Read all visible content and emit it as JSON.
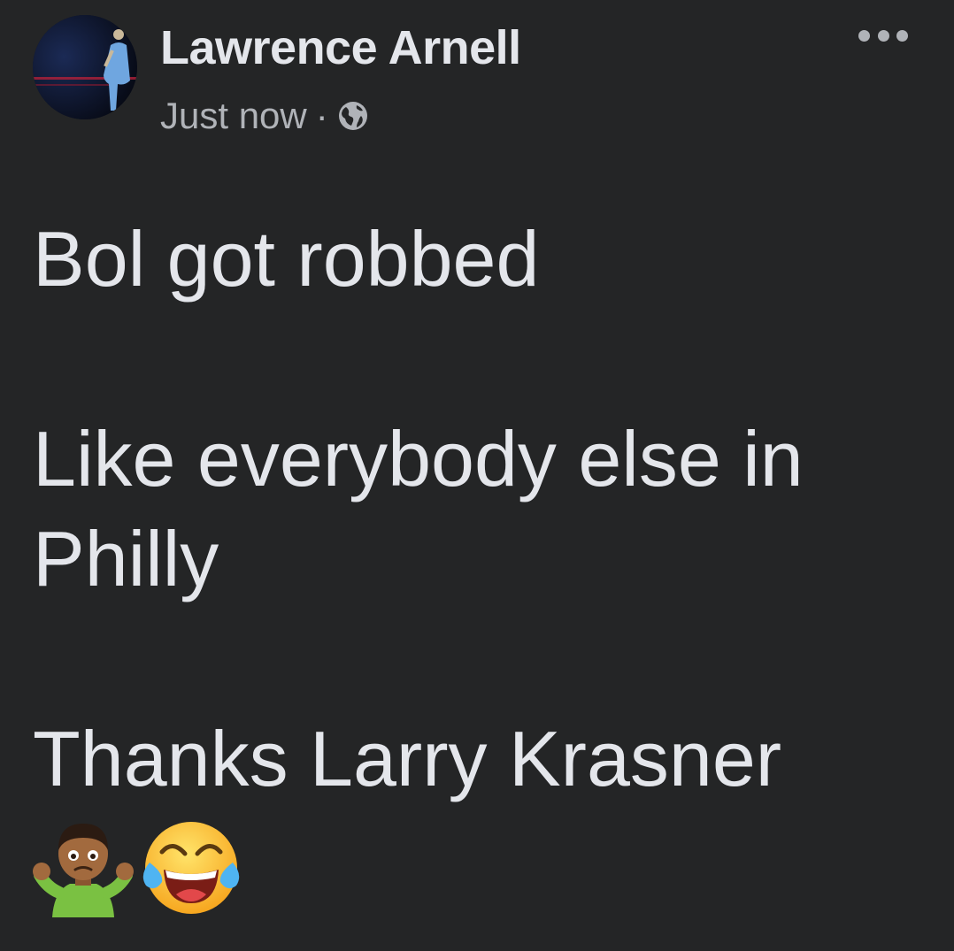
{
  "post": {
    "author_name": "Lawrence Arnell",
    "timestamp": "Just now",
    "separator": "·",
    "privacy_icon": "globe-icon",
    "more_icon": "more-options-icon",
    "lines": [
      "Bol got robbed",
      "",
      "Like everybody else in",
      "Philly",
      "",
      "Thanks Larry Krasner"
    ],
    "emojis": [
      "man-shrugging-emoji",
      "face-with-tears-of-joy-emoji"
    ]
  },
  "colors": {
    "background": "#242526",
    "primary_text": "#e4e6eb",
    "secondary_text": "#b0b3b8"
  }
}
